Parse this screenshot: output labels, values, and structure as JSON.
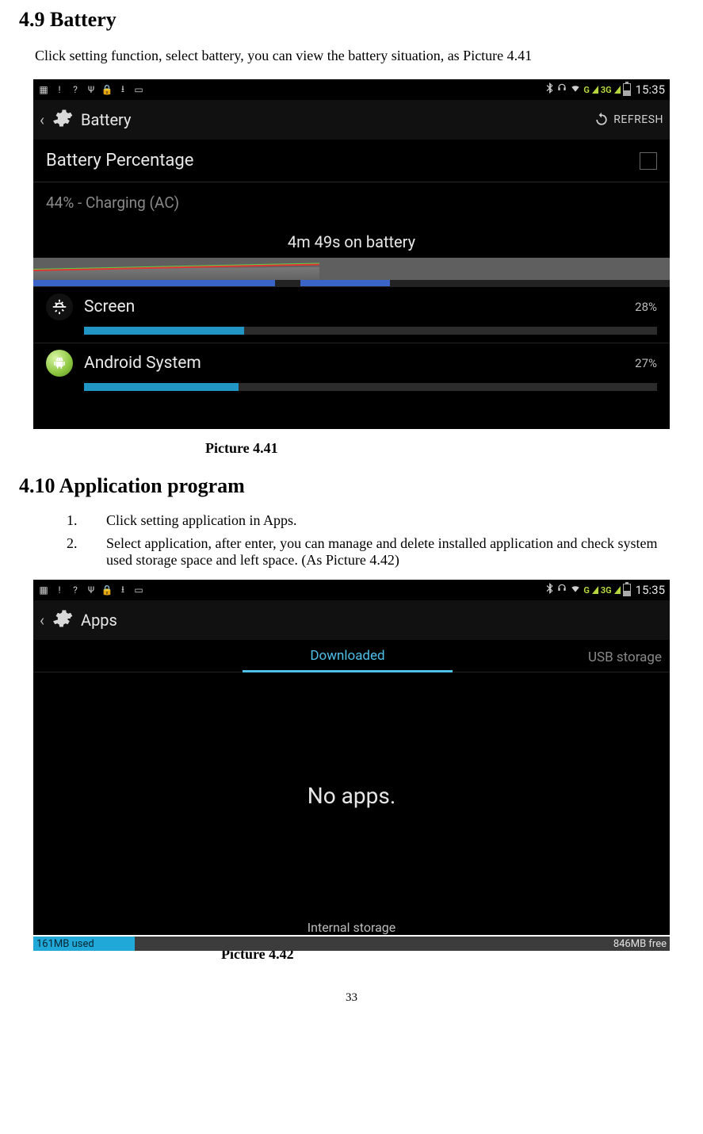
{
  "section1": {
    "heading": "4.9  Battery",
    "intro": "Click setting function, select battery, you can view the battery situation, as Picture 4.41",
    "caption": "Picture 4.41"
  },
  "section2": {
    "heading": "4.10  Application program",
    "list": {
      "n1": "1.",
      "t1": "Click setting application in Apps.",
      "n2": "2.",
      "t2": "Select application, after enter, you can manage and delete installed application and check system used storage space and left space. (As Picture 4.42)"
    },
    "caption": "Picture 4.42"
  },
  "page_number": "33",
  "shot1": {
    "status_time": "15:35",
    "status_3g": "3G",
    "status_g": "G",
    "ab_title": "Battery",
    "refresh_label": "REFRESH",
    "row_percentage_label": "Battery Percentage",
    "row_charging": "44% - Charging (AC)",
    "graph_label": "4m 49s on battery",
    "usage": {
      "screen": {
        "name": "Screen",
        "pct": "28%",
        "bar_width": "28%"
      },
      "android": {
        "name": "Android System",
        "pct": "27%",
        "bar_width": "27%"
      }
    }
  },
  "shot2": {
    "status_time": "15:35",
    "status_3g": "3G",
    "status_g": "G",
    "ab_title": "Apps",
    "tab_active": "Downloaded",
    "tab_right": "USB storage",
    "noapps": "No apps.",
    "storage_label": "Internal storage",
    "storage_used": "161MB used",
    "storage_free": "846MB free"
  }
}
